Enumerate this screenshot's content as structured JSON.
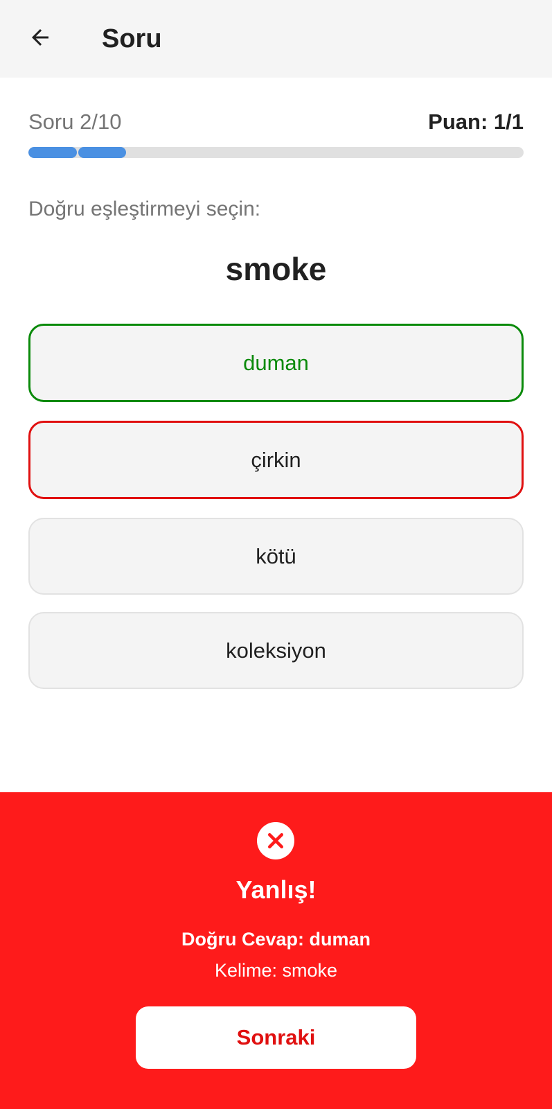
{
  "appbar": {
    "title": "Soru",
    "back_icon": "arrow-left-icon"
  },
  "progress": {
    "counter": "Soru 2/10",
    "score": "Puan: 1/1",
    "current": 2,
    "total": 10,
    "fill_color": "#4a90e2",
    "track_color": "#e0e0e0"
  },
  "question": {
    "instruction": "Doğru eşleştirmeyi seçin:",
    "word": "smoke"
  },
  "options": [
    {
      "label": "duman",
      "state": "correct"
    },
    {
      "label": "çirkin",
      "state": "wrong"
    },
    {
      "label": "kötü",
      "state": "neutral"
    },
    {
      "label": "koleksiyon",
      "state": "neutral"
    }
  ],
  "feedback": {
    "icon": "close-circle-icon",
    "title": "Yanlış!",
    "correct_answer": "Doğru Cevap: duman",
    "word_info": "Kelime: smoke",
    "next_label": "Sonraki",
    "background_color": "#fe1b1b"
  },
  "colors": {
    "correct": "#0a8a0a",
    "wrong": "#e01010"
  }
}
